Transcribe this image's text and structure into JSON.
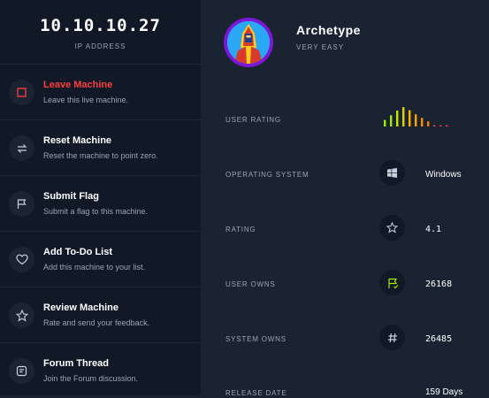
{
  "ip": {
    "address": "10.10.10.27",
    "label": "IP ADDRESS"
  },
  "menu": [
    {
      "title": "Leave Machine",
      "sub": "Leave this live machine."
    },
    {
      "title": "Reset Machine",
      "sub": "Reset the machine to point zero."
    },
    {
      "title": "Submit Flag",
      "sub": "Submit a flag to this machine."
    },
    {
      "title": "Add To-Do List",
      "sub": "Add this machine to your list."
    },
    {
      "title": "Review Machine",
      "sub": "Rate and send your feedback."
    },
    {
      "title": "Forum Thread",
      "sub": "Join the Forum discussion."
    }
  ],
  "machine": {
    "name": "Archetype",
    "difficulty": "VERY EASY"
  },
  "stats": {
    "user_rating_label": "USER RATING",
    "os_label": "OPERATING SYSTEM",
    "os_value": "Windows",
    "rating_label": "RATING",
    "rating_value": "4.1",
    "user_owns_label": "USER OWNS",
    "user_owns_value": "26168",
    "system_owns_label": "SYSTEM OWNS",
    "system_owns_value": "26485",
    "release_label": "RELEASE DATE",
    "release_value": "159 Days"
  },
  "difficulty_chart": {
    "values": [
      0.32,
      0.55,
      0.78,
      0.95,
      0.8,
      0.6,
      0.42,
      0.25,
      0.06,
      0.06,
      0.06
    ],
    "colors": [
      "#9fef00",
      "#9fef00",
      "#c5e800",
      "#e6d100",
      "#ffb300",
      "#ffa000",
      "#ff8f00",
      "#ff7a00",
      "#ff5a36",
      "#ff3e3e",
      "#ff3e3e"
    ]
  },
  "colors": {
    "accent_green": "#9fef00",
    "danger": "#ff3e3e"
  }
}
